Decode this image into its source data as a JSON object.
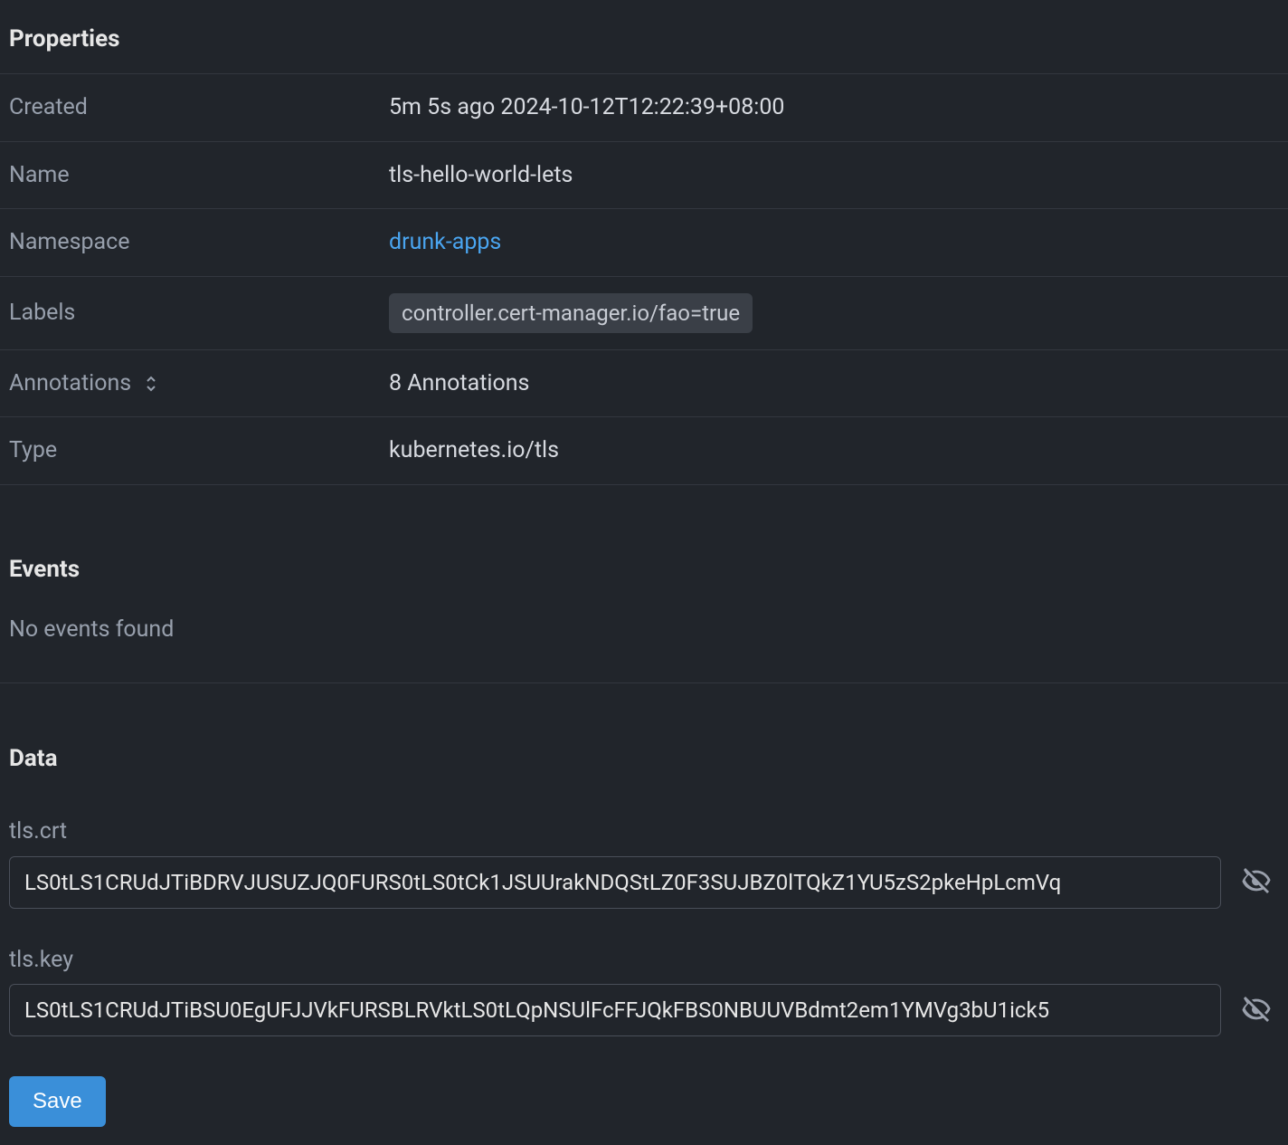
{
  "sections": {
    "properties_title": "Properties",
    "events_title": "Events",
    "data_title": "Data"
  },
  "properties": {
    "created": {
      "label": "Created",
      "value": "5m 5s ago 2024-10-12T12:22:39+08:00"
    },
    "name": {
      "label": "Name",
      "value": "tls-hello-world-lets"
    },
    "namespace": {
      "label": "Namespace",
      "value": "drunk-apps"
    },
    "labels": {
      "label": "Labels",
      "chip": "controller.cert-manager.io/fao=true"
    },
    "annotations": {
      "label": "Annotations",
      "value": "8 Annotations"
    },
    "type": {
      "label": "Type",
      "value": "kubernetes.io/tls"
    }
  },
  "events": {
    "empty": "No events found"
  },
  "data_fields": {
    "tls_crt": {
      "label": "tls.crt",
      "value": "LS0tLS1CRUdJTiBDRVJUSUZJQ0FURS0tLS0tCk1JSUUrakNDQStLZ0F3SUJBZ0lTQkZ1YU5zS2pkeHpLcmVq"
    },
    "tls_key": {
      "label": "tls.key",
      "value": "LS0tLS1CRUdJTiBSU0EgUFJJVkFURSBLRVktLS0tLQpNSUlFcFFJQkFBS0NBUUVBdmt2em1YMVg3bU1ick5"
    }
  },
  "buttons": {
    "save": "Save"
  }
}
